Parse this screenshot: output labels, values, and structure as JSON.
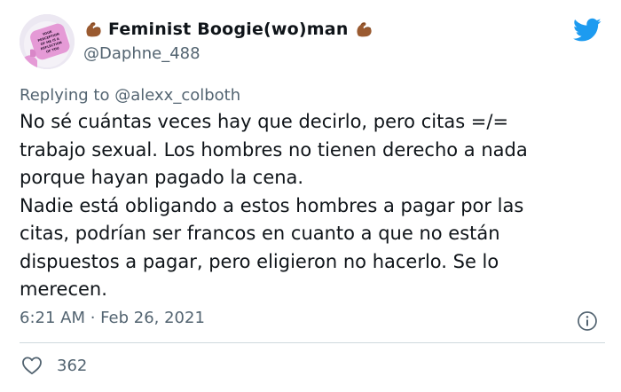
{
  "user": {
    "display_name": "Feminist Boogie(wo)man",
    "handle": "@Daphne_488",
    "avatar_text": "YOUR PERCEPTION OF ME IS A REFLECTION OF YOU",
    "emoji": "flexed-biceps"
  },
  "reply": {
    "prefix": "Replying to",
    "mention": "@alexx_colboth"
  },
  "body": {
    "lines": [
      "No sé cuántas veces hay que decirlo, pero citas =/=",
      "trabajo sexual. Los hombres no tienen derecho a nada",
      "porque hayan pagado la cena.",
      "Nadie está obligando a estos hombres a pagar por las",
      "citas, podrían ser francos en cuanto a que no están",
      "dispuestos a pagar, pero eligieron no hacerlo. Se lo",
      "merecen."
    ]
  },
  "meta": {
    "timestamp": "6:21 AM · Feb 26, 2021"
  },
  "actions": {
    "like_count": "362"
  },
  "colors": {
    "text": "#0f1419",
    "secondary": "#536471",
    "twitter_blue": "#1d9bf0",
    "divider": "#cfd9de",
    "avatar_pink": "#e59ad6"
  },
  "icons": {
    "logo": "twitter-bird-icon",
    "info": "info-icon",
    "like": "heart-icon"
  }
}
